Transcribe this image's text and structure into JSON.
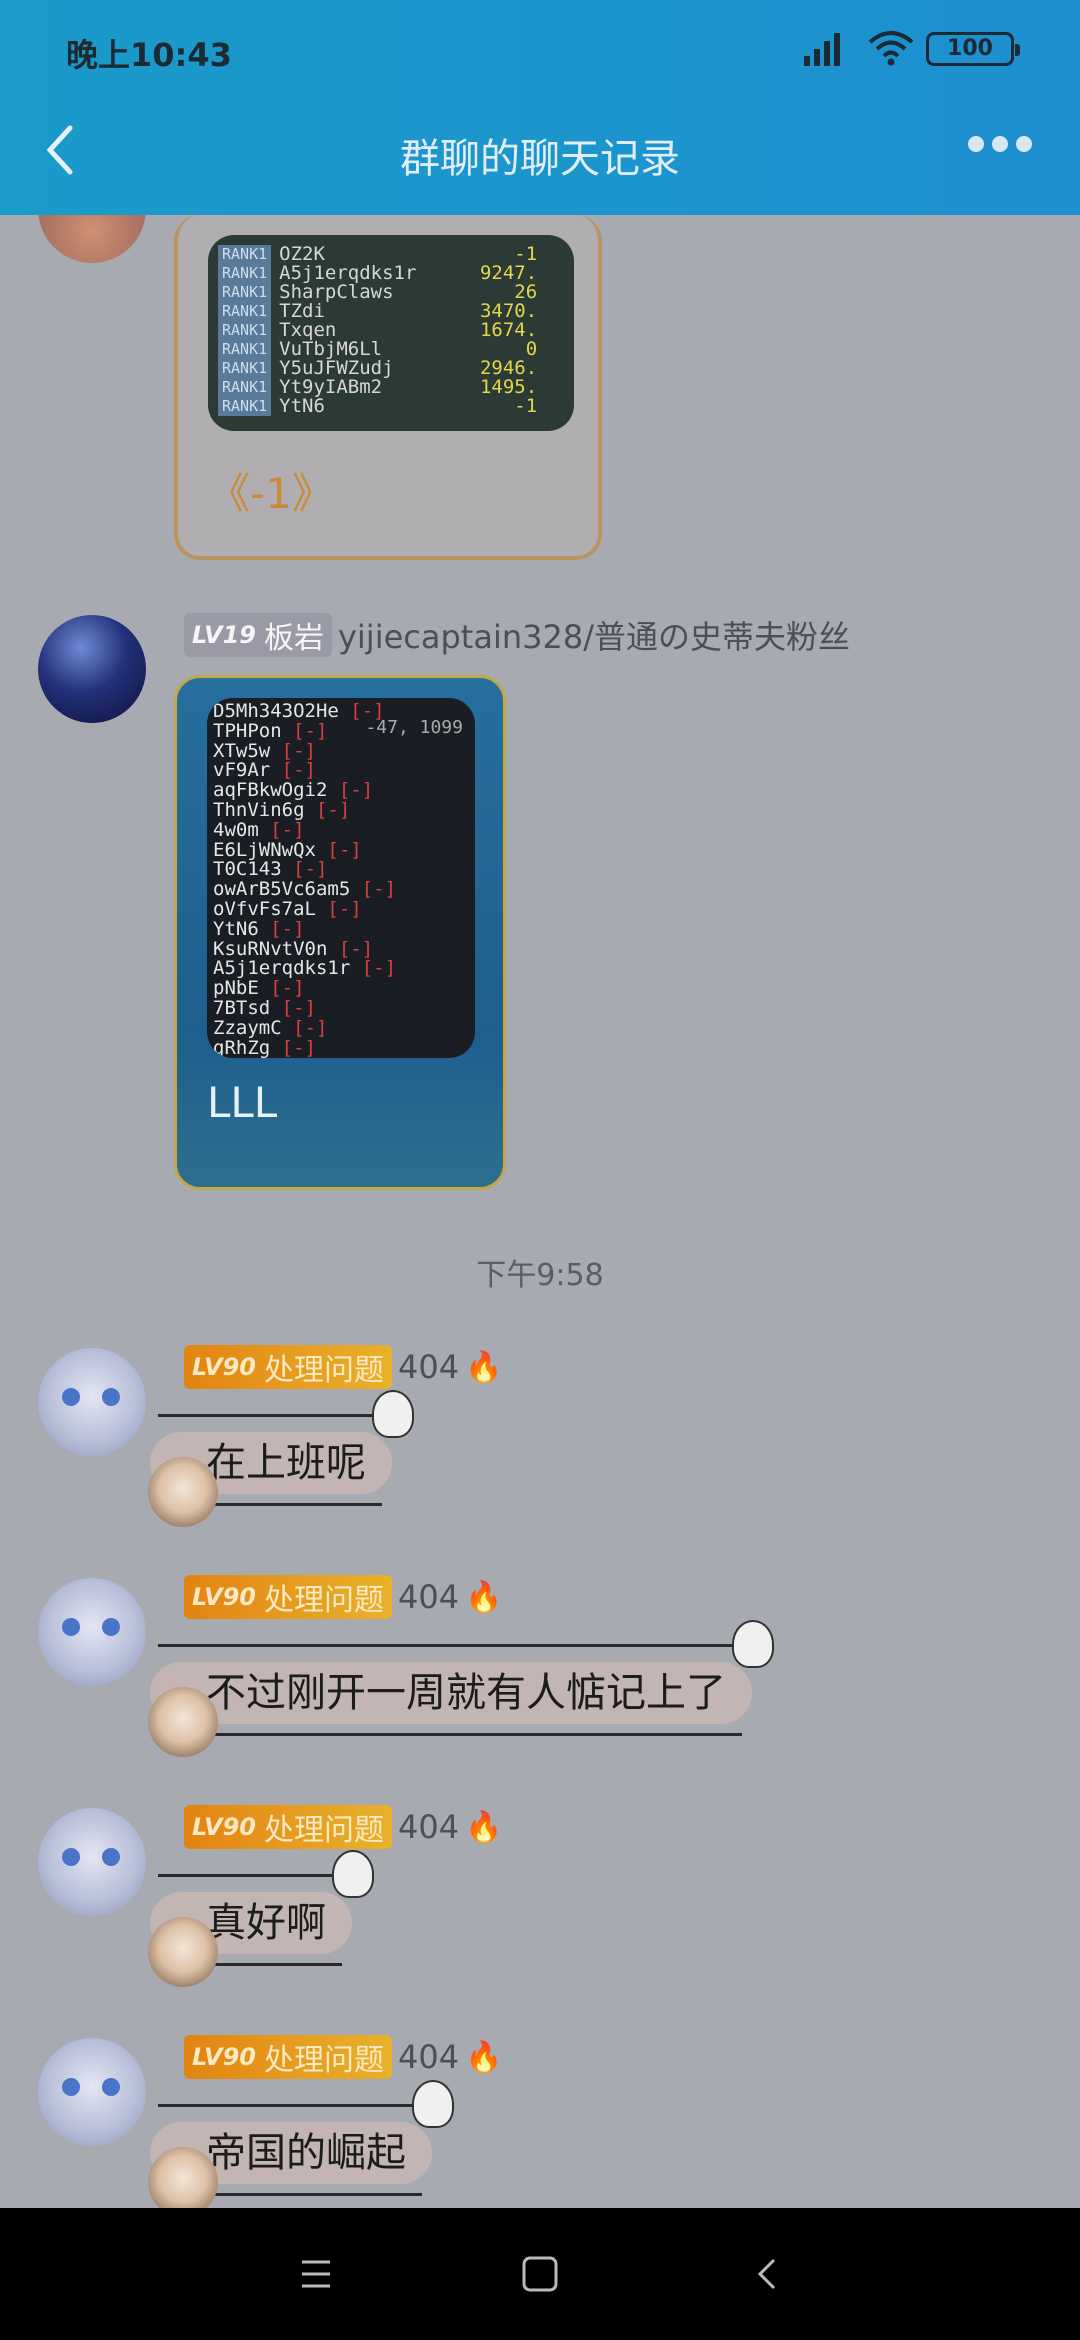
{
  "status_bar": {
    "time": "晚上10:43",
    "battery": "100"
  },
  "header": {
    "title": "群聊的聊天记录"
  },
  "chat": {
    "first_image": {
      "scoreboard_rows": [
        {
          "rank": "RANK1",
          "name": "OZ2K",
          "score": "-1"
        },
        {
          "rank": "RANK1",
          "name": "A5j1erqdks1r",
          "score": "9247."
        },
        {
          "rank": "RANK1",
          "name": "SharpClaws",
          "score": "26"
        },
        {
          "rank": "RANK1",
          "name": "TZdi",
          "score": "3470."
        },
        {
          "rank": "RANK1",
          "name": "Txqen",
          "score": "1674."
        },
        {
          "rank": "RANK1",
          "name": "VuTbjM6Ll",
          "score": "0"
        },
        {
          "rank": "RANK1",
          "name": "Y5uJFWZudj",
          "score": "2946."
        },
        {
          "rank": "RANK1",
          "name": "Yt9yIABm2",
          "score": "1495."
        },
        {
          "rank": "RANK1",
          "name": "YtN6",
          "score": "-1"
        }
      ],
      "caption": "《-1》"
    },
    "second_message": {
      "level": "LV19",
      "level_title": "板岩",
      "sender": "yijiecaptain328/普通の史蒂夫粉丝",
      "image_lines": [
        "D5Mh343O2He",
        "TPHPon",
        "XTw5w",
        "vF9Ar",
        "aqFBkwOgi2",
        "ThnVin6g",
        "4w0m",
        "E6LjWNwQx",
        "T0C143",
        "owArB5Vc6am5",
        "oVfvFs7aL",
        "YtN6",
        "KsuRNvtV0n",
        "A5j1erqdks1r",
        "pNbE",
        "7BTsd",
        "ZzaymC",
        "gRhZg"
      ],
      "image_overlay": "-47, 1099",
      "marker": "[-]",
      "caption": "LLL"
    },
    "timestamp": "下午9:58",
    "text_messages": [
      {
        "level": "LV90",
        "level_title": "处理问题",
        "sender": "404",
        "text": "在上班呢"
      },
      {
        "level": "LV90",
        "level_title": "处理问题",
        "sender": "404",
        "text": "不过刚开一周就有人惦记上了"
      },
      {
        "level": "LV90",
        "level_title": "处理问题",
        "sender": "404",
        "text": "真好啊"
      },
      {
        "level": "LV90",
        "level_title": "处理问题",
        "sender": "404",
        "text": "帝国的崛起"
      }
    ]
  },
  "icons": {
    "back": "chevron-left-icon",
    "more": "more-dots-icon",
    "fire": "fire-icon",
    "nav_menu": "menu-icon",
    "nav_home": "square-home-icon",
    "nav_back": "back-triangle-icon"
  }
}
